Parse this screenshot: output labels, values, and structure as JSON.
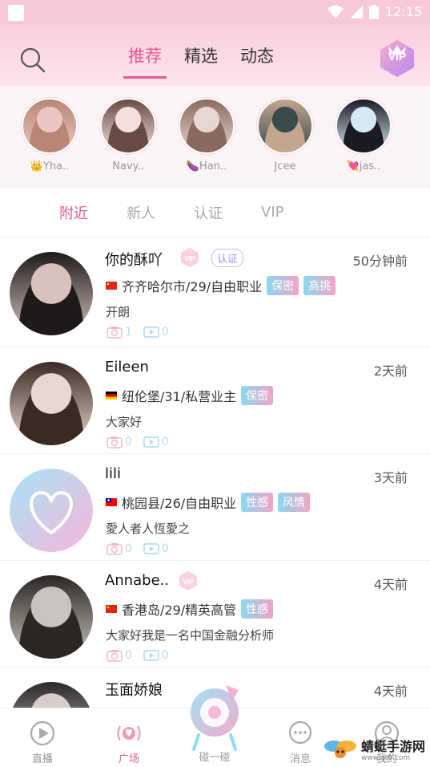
{
  "status_bar": {
    "time": "12:15"
  },
  "header": {
    "tabs": [
      {
        "label": "推荐"
      },
      {
        "label": "精选"
      },
      {
        "label": "动态"
      }
    ],
    "vip_label": "VIP"
  },
  "stories": [
    {
      "label": "👑Yha..",
      "colors": [
        "#e9c7c0",
        "#b98675"
      ]
    },
    {
      "label": "Navy..",
      "colors": [
        "#f3e0dc",
        "#6a4a44"
      ]
    },
    {
      "label": "🍆Han..",
      "colors": [
        "#e8d6d2",
        "#8a6a5e"
      ]
    },
    {
      "label": "Jcee",
      "colors": [
        "#3a4a4d",
        "#c4a68f"
      ]
    },
    {
      "label": "💘jas..",
      "colors": [
        "#d5e9f4",
        "#1a1a24"
      ]
    }
  ],
  "subtabs": [
    {
      "label": "附近"
    },
    {
      "label": "新人"
    },
    {
      "label": "认证"
    },
    {
      "label": "VIP"
    }
  ],
  "users": [
    {
      "name": "你的酥吖",
      "time": "50分钟前",
      "info": "齐齐哈尔市/29/自由职业",
      "tags": [
        {
          "label": "保密",
          "style": "mix"
        },
        {
          "label": "高挑",
          "style": "mix"
        }
      ],
      "bio": "开朗",
      "photos": "1",
      "videos": "0",
      "vip": true,
      "certified": "认证",
      "flag": "cn",
      "avatar": [
        "#d7c2bd",
        "#1e1a1a"
      ]
    },
    {
      "name": "Eileen",
      "time": "2天前",
      "info": "纽伦堡/31/私营业主",
      "tags": [
        {
          "label": "保密",
          "style": "mix"
        }
      ],
      "bio": "大家好",
      "photos": "0",
      "videos": "0",
      "vip": false,
      "certified": "",
      "flag": "de",
      "avatar": [
        "#e9d8cf",
        "#3a2a22"
      ]
    },
    {
      "name": "lili",
      "time": "3天前",
      "info": "桃园县/26/自由职业",
      "tags": [
        {
          "label": "性感",
          "style": "mix"
        },
        {
          "label": "风情",
          "style": "mix"
        }
      ],
      "bio": "愛人者人恆愛之",
      "photos": "0",
      "videos": "0",
      "vip": false,
      "certified": "",
      "flag": "tw",
      "avatar": [
        "#a8e4f6",
        "#f7b5d9"
      ]
    },
    {
      "name": "Annabe..",
      "time": "4天前",
      "info": "香港岛/29/精英高管",
      "tags": [
        {
          "label": "性感",
          "style": "mix"
        }
      ],
      "bio": "大家好我是一名中国金融分析师",
      "photos": "0",
      "videos": "0",
      "vip": true,
      "certified": "",
      "flag": "cn",
      "avatar": [
        "#c9c4bc",
        "#2b2622"
      ]
    },
    {
      "name": "玉面娇娘",
      "time": "4天前",
      "info": "",
      "tags": [],
      "bio": "",
      "photos": "",
      "videos": "",
      "vip": false,
      "certified": "",
      "flag": "",
      "avatar": [
        "#d8cdc8",
        "#2a2a2a"
      ]
    }
  ],
  "bottom_nav": [
    {
      "label": "直播",
      "icon": "play-icon"
    },
    {
      "label": "广场",
      "icon": "broadcast-icon"
    },
    {
      "label": "碰一碰",
      "icon": "camera-bot-icon"
    },
    {
      "label": "消息",
      "icon": "chat-icon"
    },
    {
      "label": "我的",
      "icon": "profile-icon"
    }
  ],
  "watermark": {
    "text": "蜻蜓手游网",
    "url": "www.qt6.com"
  },
  "colors": {
    "accent": "#e25b93",
    "header_bg": "#f9cfdf"
  }
}
